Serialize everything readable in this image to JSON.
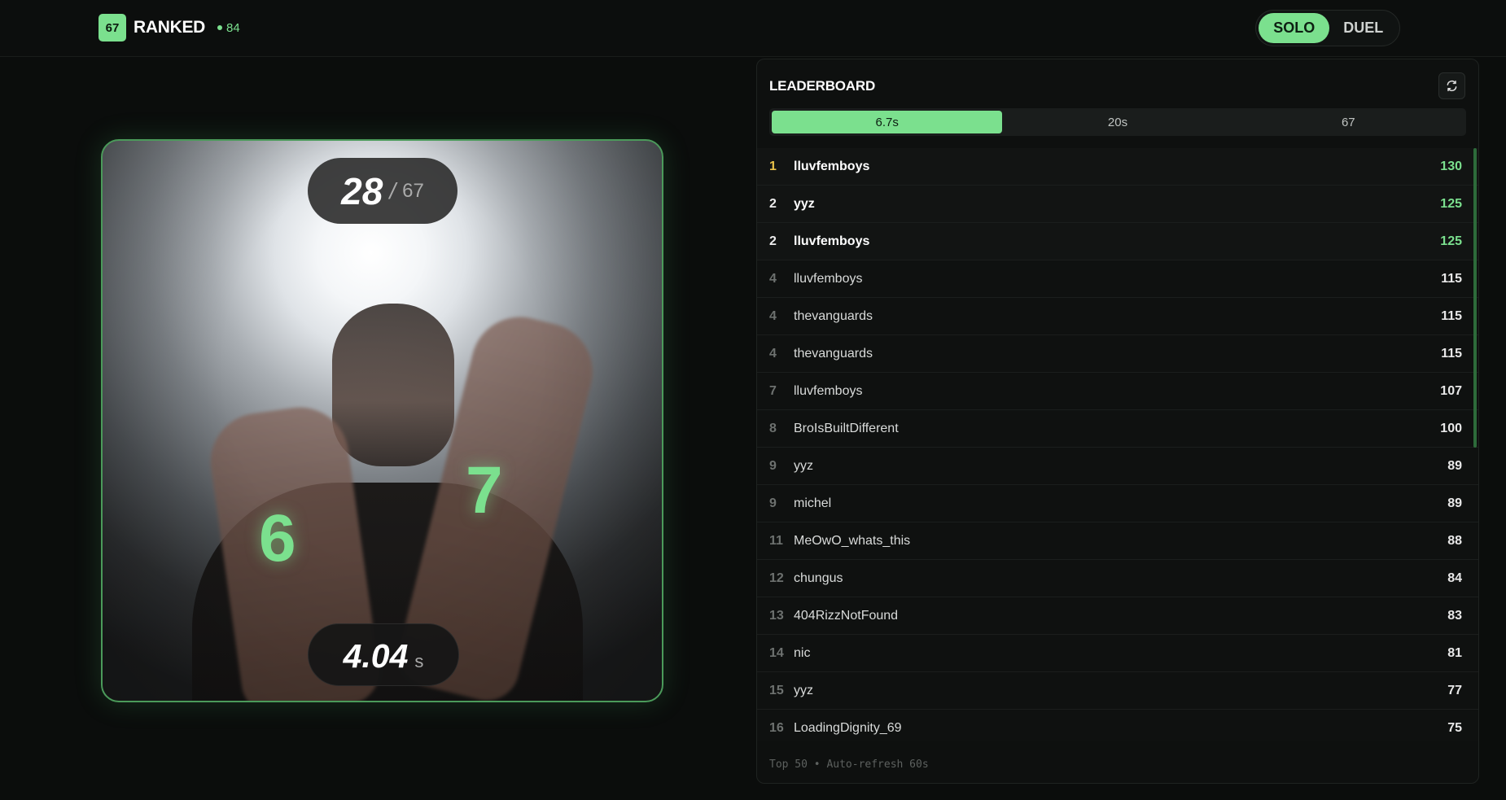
{
  "header": {
    "logo_badge": "67",
    "title": "RANKED",
    "online_count": "84",
    "modes": [
      {
        "label": "SOLO",
        "active": true
      },
      {
        "label": "DUEL",
        "active": false
      }
    ]
  },
  "game": {
    "count_current": "28",
    "count_sep": "/",
    "count_target": "67",
    "timer_value": "4.04",
    "timer_unit": "s",
    "hand_left_digit": "6",
    "hand_right_digit": "7"
  },
  "leaderboard": {
    "title": "LEADERBOARD",
    "refresh_icon": "refresh-icon",
    "tabs": [
      {
        "label": "6.7s",
        "active": true
      },
      {
        "label": "20s",
        "active": false
      },
      {
        "label": "67",
        "active": false
      }
    ],
    "rows": [
      {
        "rank": "1",
        "name": "lluvfemboys",
        "score": "130"
      },
      {
        "rank": "2",
        "name": "yyz",
        "score": "125"
      },
      {
        "rank": "2",
        "name": "lluvfemboys",
        "score": "125"
      },
      {
        "rank": "4",
        "name": "lluvfemboys",
        "score": "115"
      },
      {
        "rank": "4",
        "name": "thevanguards",
        "score": "115"
      },
      {
        "rank": "4",
        "name": "thevanguards",
        "score": "115"
      },
      {
        "rank": "7",
        "name": "lluvfemboys",
        "score": "107"
      },
      {
        "rank": "8",
        "name": "BroIsBuiltDifferent",
        "score": "100"
      },
      {
        "rank": "9",
        "name": "yyz",
        "score": "89"
      },
      {
        "rank": "9",
        "name": "michel",
        "score": "89"
      },
      {
        "rank": "11",
        "name": "MeOwO_whats_this",
        "score": "88"
      },
      {
        "rank": "12",
        "name": "chungus",
        "score": "84"
      },
      {
        "rank": "13",
        "name": "404RizzNotFound",
        "score": "83"
      },
      {
        "rank": "14",
        "name": "nic",
        "score": "81"
      },
      {
        "rank": "15",
        "name": "yyz",
        "score": "77"
      },
      {
        "rank": "16",
        "name": "LoadingDignity_69",
        "score": "75"
      }
    ],
    "footer": "Top 50 • Auto-refresh 60s"
  },
  "colors": {
    "accent": "#7be08e",
    "gold": "#e8c14a",
    "background": "#0b0d0c"
  }
}
